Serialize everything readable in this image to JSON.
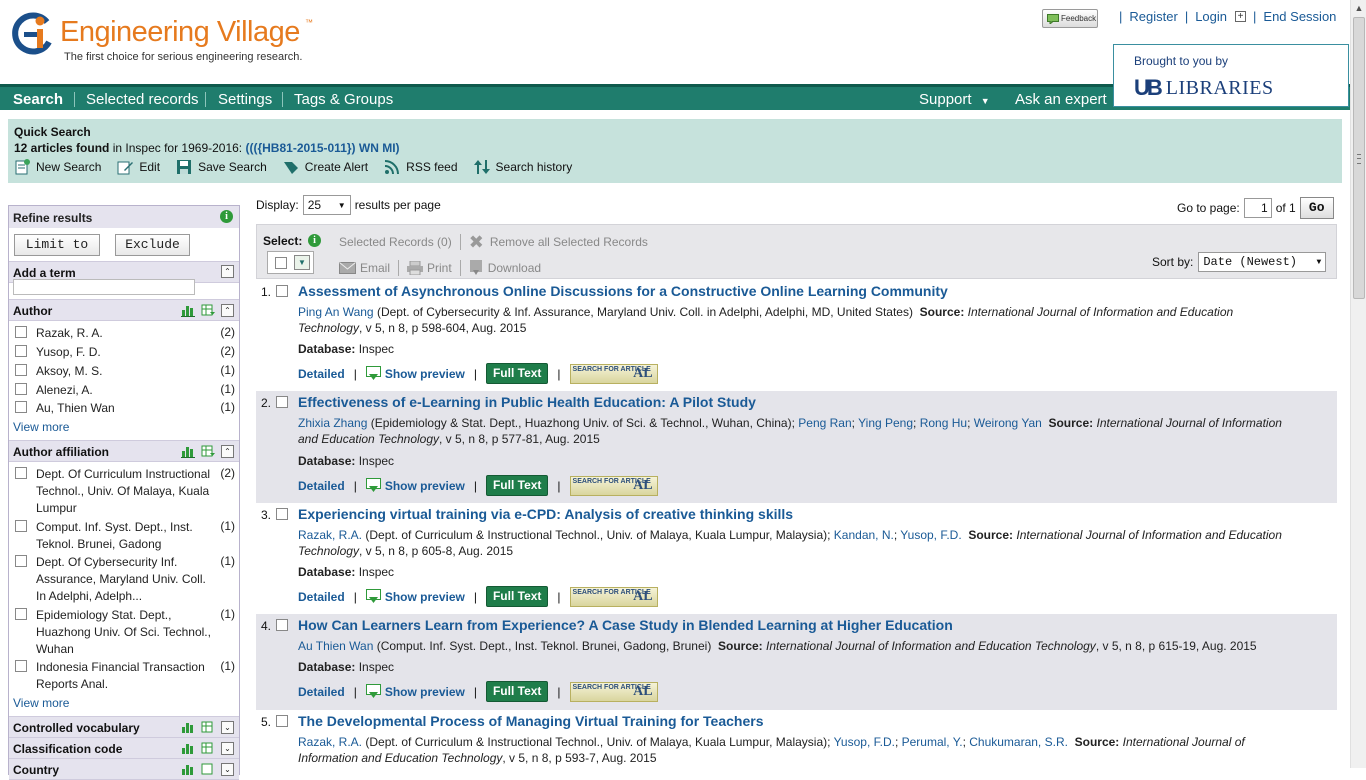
{
  "header": {
    "logo_text": "Engineering Village",
    "logo_tm": "™",
    "tagline": "The first choice for serious engineering research.",
    "feedback_label": "Feedback",
    "links": {
      "register": "Register",
      "login": "Login",
      "end_session": "End Session"
    },
    "brought_by": "Brought to you by",
    "ub_mark": "UB",
    "ub_libraries": "LIBRARIES"
  },
  "nav": {
    "search": "Search",
    "selected_records": "Selected records",
    "settings": "Settings",
    "tags_groups": "Tags & Groups",
    "support": "Support",
    "ask_expert": "Ask an expert"
  },
  "quick_search": {
    "title": "Quick Search",
    "count_text": "12 articles found",
    "in_text": "in Inspec for 1969-2016:",
    "query": "((({HB81-2015-011}) WN MI)",
    "actions": [
      "New Search",
      "Edit",
      "Save Search",
      "Create Alert",
      "RSS feed",
      "Search history"
    ]
  },
  "refine": {
    "title": "Refine results",
    "limit_to": "Limit to",
    "exclude": "Exclude",
    "add_term": "Add a term",
    "author": {
      "title": "Author",
      "items": [
        {
          "label": "Razak, R. A.",
          "count": "(2)"
        },
        {
          "label": "Yusop, F. D.",
          "count": "(2)"
        },
        {
          "label": "Aksoy, M. S.",
          "count": "(1)"
        },
        {
          "label": "Alenezi, A.",
          "count": "(1)"
        },
        {
          "label": "Au, Thien Wan",
          "count": "(1)"
        }
      ],
      "view_more": "View more"
    },
    "affiliation": {
      "title": "Author affiliation",
      "items": [
        {
          "label": "Dept. Of Curriculum Instructional Technol., Univ. Of Malaya, Kuala Lumpur",
          "count": "(2)"
        },
        {
          "label": "Comput. Inf. Syst. Dept., Inst. Teknol. Brunei, Gadong",
          "count": "(1)"
        },
        {
          "label": "Dept. Of Cybersecurity Inf. Assurance, Maryland Univ. Coll. In Adelphi, Adelph...",
          "count": "(1)"
        },
        {
          "label": "Epidemiology Stat. Dept., Huazhong Univ. Of Sci. Technol., Wuhan",
          "count": "(1)"
        },
        {
          "label": "Indonesia Financial Transaction Reports Anal.",
          "count": "(1)"
        }
      ],
      "view_more": "View more"
    },
    "controlled_vocabulary": "Controlled vocabulary",
    "classification_code": "Classification code",
    "country": "Country"
  },
  "results_controls": {
    "display_label": "Display:",
    "display_value": "25",
    "per_page": "results per page",
    "goto_label": "Go to page:",
    "goto_value": "1",
    "of_pages": "of 1",
    "go": "Go",
    "select_label": "Select:",
    "selected_records": "Selected Records (0)",
    "remove_all": "Remove all Selected Records",
    "email": "Email",
    "print": "Print",
    "download": "Download",
    "sort_label": "Sort by:",
    "sort_value": "Date (Newest)"
  },
  "result_common": {
    "detailed": "Detailed",
    "show_preview": "Show preview",
    "full_text": "Full Text",
    "db_label": "Database:",
    "db_value": "Inspec",
    "source_label": "Source:",
    "sfa_text": "SEARCH FOR ARTICLE",
    "sfa_mark": "AL"
  },
  "results": [
    {
      "num": "1.",
      "title": "Assessment of Asynchronous Online Discussions for a Constructive Online Learning Community",
      "authors": [
        {
          "name": "Ping An Wang",
          "aff": " (Dept. of Cybersecurity & Inf. Assurance, Maryland Univ. Coll. in Adelphi, Adelphi, MD, United States)"
        }
      ],
      "journal": "International Journal of Information and Education Technology",
      "details": ", v 5, n 8, p 598-604, Aug. 2015"
    },
    {
      "num": "2.",
      "title": "Effectiveness of e-Learning in Public Health Education: A Pilot Study",
      "authors": [
        {
          "name": "Zhixia Zhang",
          "aff": " (Epidemiology & Stat. Dept., Huazhong Univ. of Sci. & Technol., Wuhan, China); "
        },
        {
          "name": "Peng Ran",
          "aff": "; "
        },
        {
          "name": "Ying Peng",
          "aff": "; "
        },
        {
          "name": "Rong Hu",
          "aff": "; "
        },
        {
          "name": "Weirong Yan",
          "aff": ""
        }
      ],
      "journal": "International Journal of Information and Education Technology",
      "details": ", v 5, n 8, p 577-81, Aug. 2015"
    },
    {
      "num": "3.",
      "title": "Experiencing virtual training via e-CPD: Analysis of creative thinking skills",
      "authors": [
        {
          "name": "Razak, R.A.",
          "aff": " (Dept. of Curriculum & Instructional Technol., Univ. of Malaya, Kuala Lumpur, Malaysia); "
        },
        {
          "name": "Kandan, N.",
          "aff": "; "
        },
        {
          "name": "Yusop, F.D.",
          "aff": ""
        }
      ],
      "journal": "International Journal of Information and Education Technology",
      "details": ", v 5, n 8, p 605-8, Aug. 2015"
    },
    {
      "num": "4.",
      "title": "How Can Learners Learn from Experience? A Case Study in Blended Learning at Higher Education",
      "authors": [
        {
          "name": "Au Thien Wan",
          "aff": " (Comput. Inf. Syst. Dept., Inst. Teknol. Brunei, Gadong, Brunei)"
        }
      ],
      "journal": "International Journal of Information and Education Technology",
      "details": ", v 5, n 8, p 615-19, Aug. 2015"
    },
    {
      "num": "5.",
      "title": "The Developmental Process of Managing Virtual Training for Teachers",
      "authors": [
        {
          "name": "Razak, R.A.",
          "aff": " (Dept. of Curriculum & Instructional Technol., Univ. of Malaya, Kuala Lumpur, Malaysia); "
        },
        {
          "name": "Yusop, F.D.",
          "aff": "; "
        },
        {
          "name": "Perumal, Y.",
          "aff": "; "
        },
        {
          "name": "Chukumaran, S.R.",
          "aff": ""
        }
      ],
      "journal": "International Journal of Information and Education Technology",
      "details": ", v 5, n 8, p 593-7, Aug. 2015"
    }
  ],
  "colors": {
    "nav_bg": "#1f7d6d",
    "qs_bg": "#c6e2dc",
    "link": "#1a5a96",
    "logo_orange": "#e67a1e",
    "full_text_bg": "#1f7d4a"
  }
}
